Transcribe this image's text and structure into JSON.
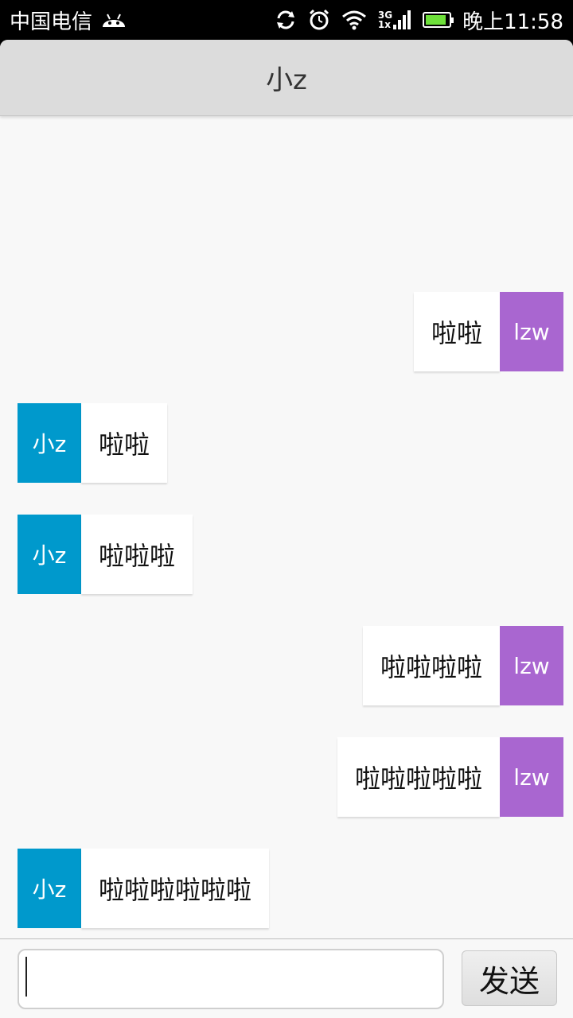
{
  "status_bar": {
    "carrier": "中国电信",
    "network_top": "3G",
    "network_bottom": "1x",
    "time": "晚上11:58",
    "icons": [
      "android-icon",
      "sync-icon",
      "alarm-icon",
      "wifi-icon",
      "signal-icon",
      "battery-icon"
    ],
    "battery_level": 0.9
  },
  "header": {
    "title": "小z"
  },
  "colors": {
    "me_avatar": "#a966d0",
    "other_avatar": "#0099cc"
  },
  "messages": [
    {
      "side": "right",
      "text": "啦啦",
      "avatar": "lzw"
    },
    {
      "side": "left",
      "text": "啦啦",
      "avatar": "小z"
    },
    {
      "side": "left",
      "text": "啦啦啦",
      "avatar": "小z"
    },
    {
      "side": "right",
      "text": "啦啦啦啦",
      "avatar": "lzw"
    },
    {
      "side": "right",
      "text": "啦啦啦啦啦",
      "avatar": "lzw"
    },
    {
      "side": "left",
      "text": "啦啦啦啦啦啦",
      "avatar": "小z"
    }
  ],
  "input": {
    "value": "",
    "send_label": "发送"
  }
}
